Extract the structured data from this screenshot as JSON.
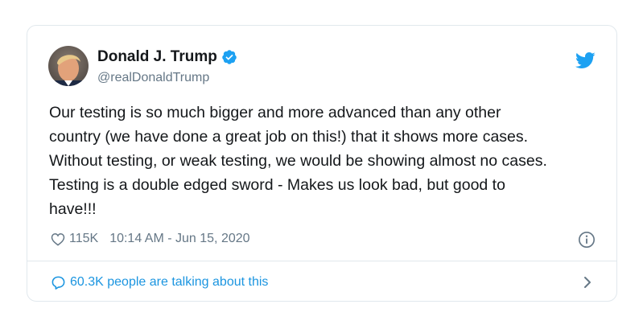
{
  "tweet": {
    "display_name": "Donald J. Trump",
    "handle": "@realDonaldTrump",
    "text_lines": [
      "Our testing is so much bigger and more advanced than any other",
      "country (we have done a great job on this!) that it shows more cases.",
      "Without testing, or weak testing, we would be showing almost no cases.",
      "Testing is a double edged sword - Makes us look bad, but good to",
      "have!!!"
    ],
    "like_count": "115K",
    "timestamp": "10:14 AM - Jun 15, 2020",
    "talking_text": "60.3K people are talking about this"
  },
  "icons": {
    "verified": "verified-badge-icon",
    "brand": "twitter-bird-icon",
    "like": "heart-icon",
    "info": "info-icon",
    "comment": "comment-icon",
    "chevron": "chevron-right-icon"
  },
  "colors": {
    "brand_blue": "#1da1f2",
    "link_blue": "#1b95e0",
    "muted_gray": "#657786",
    "text": "#14171a",
    "border": "#e1e8ed"
  }
}
